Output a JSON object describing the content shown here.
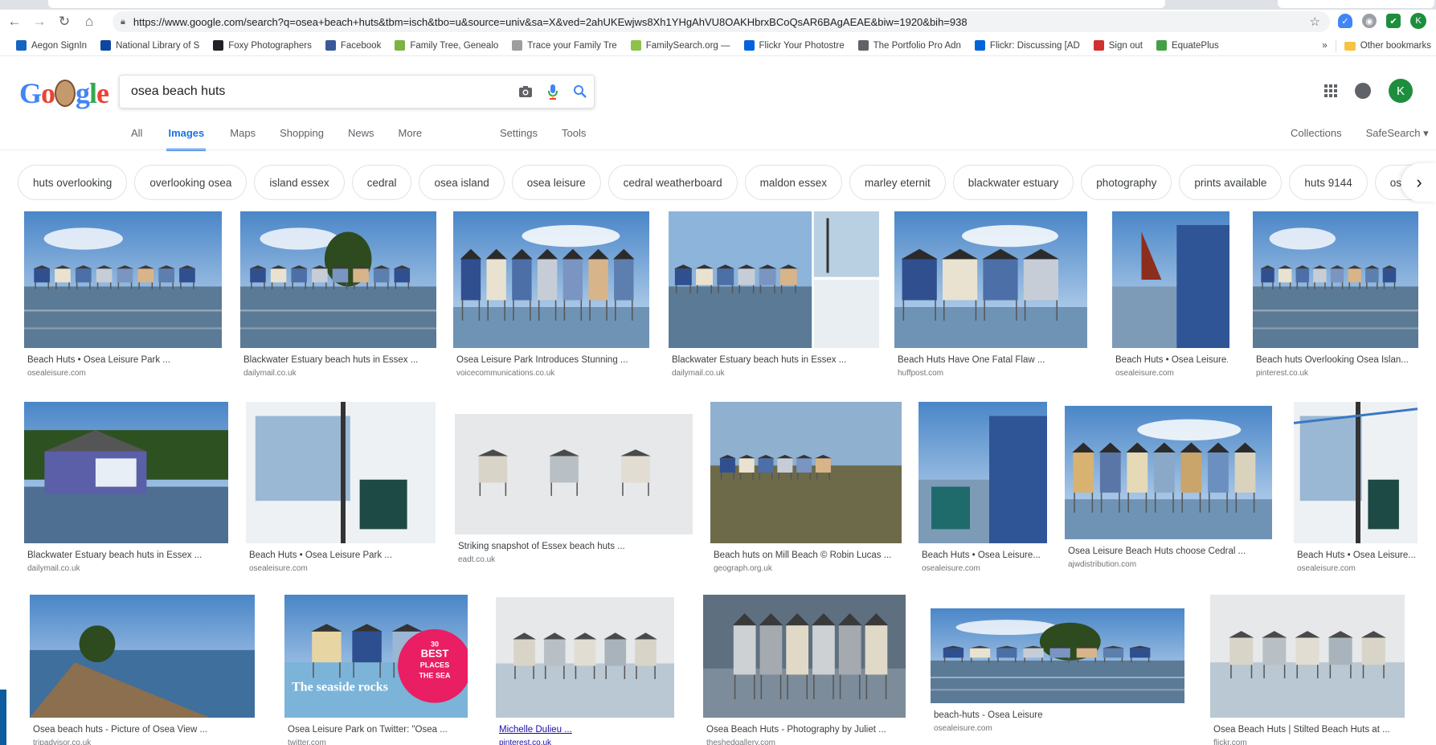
{
  "browser": {
    "url": "https://www.google.com/search?q=osea+beach+huts&tbm=isch&tbo=u&source=univ&sa=X&ved=2ahUKEwjws8Xh1YHgAhVU8OAKHbrxBCoQsAR6BAgAEAE&biw=1920&bih=938",
    "profile_initial": "K",
    "bookmarks": [
      {
        "label": "Aegon SignIn",
        "icon": "aegon-icon",
        "color": "#1565c0"
      },
      {
        "label": "National Library of S",
        "icon": "library-icon",
        "color": "#0d47a1"
      },
      {
        "label": "Foxy Photographers",
        "icon": "pin-icon",
        "color": "#202124"
      },
      {
        "label": "Facebook",
        "icon": "facebook-icon",
        "color": "#3b5998"
      },
      {
        "label": "Family Tree, Genealo",
        "icon": "tree-icon",
        "color": "#7cb342"
      },
      {
        "label": "Trace your Family Tre",
        "icon": "loading-icon",
        "color": "#9e9e9e"
      },
      {
        "label": "FamilySearch.org — ",
        "icon": "familysearch-icon",
        "color": "#8bc34a"
      },
      {
        "label": "Flickr Your Photostre",
        "icon": "flickr-icon",
        "color": "#0063dc"
      },
      {
        "label": "The Portfolio Pro Adn",
        "icon": "page-icon",
        "color": "#5f6368"
      },
      {
        "label": "Flickr: Discussing [AD",
        "icon": "flickr-icon",
        "color": "#0063dc"
      },
      {
        "label": "Sign out",
        "icon": "eq-icon",
        "color": "#d32f2f"
      },
      {
        "label": "EquatePlus",
        "icon": "equateplus-icon",
        "color": "#43a047"
      }
    ],
    "overflow_label": "»",
    "other_bookmarks": "Other bookmarks"
  },
  "search": {
    "query": "osea beach huts"
  },
  "tabs": [
    "All",
    "Images",
    "Maps",
    "Shopping",
    "News",
    "More"
  ],
  "active_tab": "Images",
  "tools": {
    "settings": "Settings",
    "tools": "Tools"
  },
  "right_links": {
    "collections": "Collections",
    "safesearch": "SafeSearch ▾"
  },
  "chips": [
    "huts overlooking",
    "overlooking osea",
    "island essex",
    "cedral",
    "osea island",
    "osea leisure",
    "cedral weatherboard",
    "maldon essex",
    "marley eternit",
    "blackwater estuary",
    "photography",
    "prints available",
    "huts 9144",
    "osea mini"
  ],
  "results": [
    {
      "title": "Beach Huts • Osea Leisure Park ...",
      "domain": "osealeisure.com",
      "scene": "far"
    },
    {
      "title": "Blackwater Estuary beach huts in Essex ...",
      "domain": "dailymail.co.uk",
      "scene": "row"
    },
    {
      "title": "Osea Leisure Park Introduces Stunning ...",
      "domain": "voicecommunications.co.uk",
      "scene": "sky"
    },
    {
      "title": "Blackwater Estuary beach huts in Essex ...",
      "domain": "dailymail.co.uk",
      "scene": "collage"
    },
    {
      "title": "Beach Huts Have One Fatal Flaw ...",
      "domain": "huffpost.com",
      "scene": "close"
    },
    {
      "title": "Beach Huts • Osea Leisure...",
      "domain": "osealeisure.com",
      "scene": "sail"
    },
    {
      "title": "Beach huts Overlooking Osea Islan...",
      "domain": "pinterest.co.uk",
      "scene": "far"
    },
    {
      "title": "Blackwater Estuary beach huts in Essex ...",
      "domain": "dailymail.co.uk",
      "scene": "single"
    },
    {
      "title": "Beach Huts • Osea Leisure Park ...",
      "domain": "osealeisure.com",
      "scene": "interior"
    },
    {
      "title": "Striking snapshot of Essex beach huts ...",
      "domain": "eadt.co.uk",
      "scene": "mist"
    },
    {
      "title": "Beach huts on Mill Beach © Robin Lucas ...",
      "domain": "geograph.org.uk",
      "scene": "shore"
    },
    {
      "title": "Beach Huts • Osea Leisure...",
      "domain": "osealeisure.com",
      "scene": "window"
    },
    {
      "title": "Osea Leisure Beach Huts choose Cedral ...",
      "domain": "ajwdistribution.com",
      "scene": "colored"
    },
    {
      "title": "Beach Huts • Osea Leisure...",
      "domain": "osealeisure.com",
      "scene": "room"
    },
    {
      "title": "Osea beach huts - Picture of Osea View ...",
      "domain": "tripadvisor.co.uk",
      "scene": "beach"
    },
    {
      "title": "Osea Leisure Park on Twitter: \"Osea ...",
      "domain": "twitter.com",
      "scene": "magazine",
      "overlay_title": "The seaside rocks",
      "badge": [
        "30",
        "BEST",
        "PLACES",
        "THE SEA"
      ]
    },
    {
      "title": "Michelle Dulieu ...",
      "domain": "pinterest.co.uk",
      "scene": "pale",
      "link": true
    },
    {
      "title": "Osea Beach Huts - Photography by Juliet ...",
      "domain": "theshedgallery.com",
      "scene": "dusk"
    },
    {
      "title": "beach-huts - Osea Leisure",
      "domain": "osealeisure.com",
      "scene": "row"
    },
    {
      "title": "Osea Beach Huts | Stilted Beach Huts at ...",
      "domain": "flickr.com",
      "scene": "pale"
    }
  ]
}
